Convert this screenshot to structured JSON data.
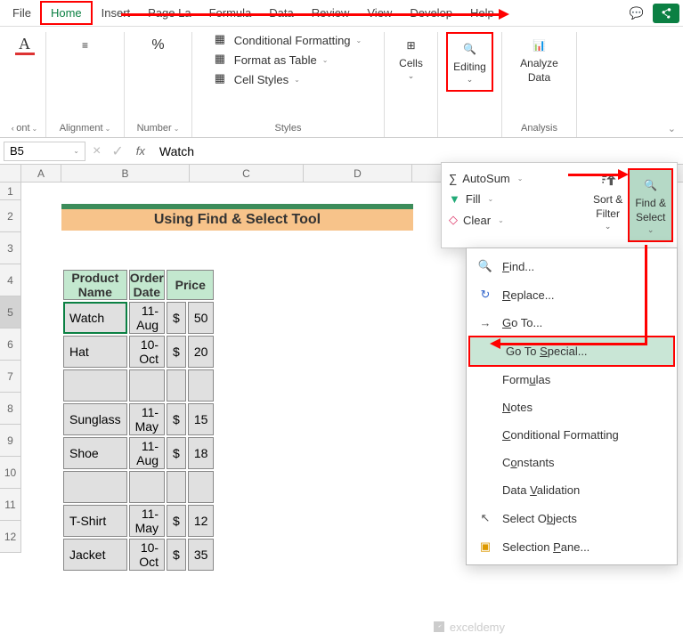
{
  "tabs": {
    "file": "File",
    "home": "Home",
    "insert": "Insert",
    "pagelayout": "Page La",
    "formulas": "Formula",
    "data": "Data",
    "review": "Review",
    "view": "View",
    "developer": "Develop",
    "help": "Help"
  },
  "ribbon": {
    "font_label": "ont",
    "alignment_label": "Alignment",
    "number_label": "Number",
    "styles_label": "Styles",
    "cond_fmt": "Conditional Formatting",
    "fmt_table": "Format as Table",
    "cell_styles": "Cell Styles",
    "cells_label": "Cells",
    "editing_label": "Editing",
    "analyze_label": "Analyze",
    "analyze_sub": "Data",
    "analysis_label": "Analysis"
  },
  "edit_panel": {
    "autosum": "AutoSum",
    "fill": "Fill",
    "clear": "Clear",
    "sort_filter1": "Sort &",
    "sort_filter2": "Filter",
    "find_select1": "Find &",
    "find_select2": "Select"
  },
  "fs_menu": {
    "find": "Find...",
    "replace": "Replace...",
    "goto": "Go To...",
    "gotospecial": "Go To Special...",
    "formulas": "Formulas",
    "notes": "Notes",
    "condfmt": "Conditional Formatting",
    "constants": "Constants",
    "dataval": "Data Validation",
    "selobj": "Select Objects",
    "selpane": "Selection Pane..."
  },
  "namebox": "B5",
  "formula": "Watch",
  "columns": [
    "A",
    "B",
    "C",
    "D"
  ],
  "title_band": "Using Find & Select Tool",
  "headers": {
    "product": "Product Name",
    "order": "Order Date",
    "price": "Price"
  },
  "table": [
    {
      "product": "Watch",
      "date": "11-Aug",
      "cur": "$",
      "price": "50"
    },
    {
      "product": "Hat",
      "date": "10-Oct",
      "cur": "$",
      "price": "20"
    },
    {
      "product": "",
      "date": "",
      "cur": "",
      "price": ""
    },
    {
      "product": "Sunglass",
      "date": "11-May",
      "cur": "$",
      "price": "15"
    },
    {
      "product": "Shoe",
      "date": "11-Aug",
      "cur": "$",
      "price": "18"
    },
    {
      "product": "",
      "date": "",
      "cur": "",
      "price": ""
    },
    {
      "product": "T-Shirt",
      "date": "11-May",
      "cur": "$",
      "price": "12"
    },
    {
      "product": "Jacket",
      "date": "10-Oct",
      "cur": "$",
      "price": "35"
    }
  ],
  "watermark": "exceldemy"
}
